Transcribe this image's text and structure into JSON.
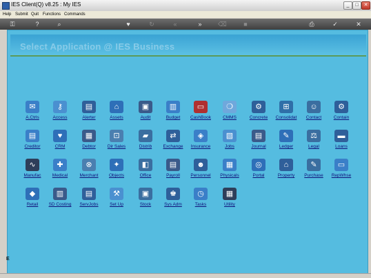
{
  "window": {
    "title": "IES Client(Q) v8.25 : My IES",
    "controls": [
      "_",
      "□",
      "✕"
    ]
  },
  "menu": {
    "items": [
      "Help",
      "Submit",
      "Quit",
      "Functions",
      "Commands"
    ]
  },
  "toolbar": {
    "buttons": [
      {
        "name": "key-icon",
        "glyph": "⚿",
        "dim": false
      },
      {
        "name": "help-icon",
        "glyph": "?",
        "dim": false
      },
      {
        "name": "search-icon",
        "glyph": "⌕",
        "dim": false
      },
      {
        "name": "heart-icon",
        "glyph": "♥",
        "dim": false
      },
      {
        "name": "refresh-icon",
        "glyph": "↻",
        "dim": true
      },
      {
        "name": "first-page-icon",
        "glyph": "«",
        "dim": true
      },
      {
        "name": "last-page-icon",
        "glyph": "»",
        "dim": false
      },
      {
        "name": "trash-icon",
        "glyph": "⌫",
        "dim": true
      },
      {
        "name": "stop-icon",
        "glyph": "■",
        "dim": true
      },
      {
        "name": "print-icon",
        "glyph": "⎙",
        "dim": false
      },
      {
        "name": "ok-icon",
        "glyph": "✓",
        "dim": false
      },
      {
        "name": "close-icon",
        "glyph": "✕",
        "dim": false
      }
    ]
  },
  "page": {
    "title": "Select Application @  IES Business",
    "bottom_marker": "E"
  },
  "colors": {
    "background": "#55bce0",
    "header": "#3aa3d4",
    "link": "#10107a"
  },
  "apps": [
    {
      "label": "A.Ctrls",
      "icon": "control-icon",
      "glyph": "✉",
      "color": "#3a7fc8"
    },
    {
      "label": "Access",
      "icon": "key-icon",
      "glyph": "⚷",
      "color": "#4a90d0"
    },
    {
      "label": "Alerter",
      "icon": "alert-panel-icon",
      "glyph": "▤",
      "color": "#2f5f9a"
    },
    {
      "label": "Assets",
      "icon": "house-icon",
      "glyph": "⌂",
      "color": "#2e6fb8"
    },
    {
      "label": "Audit",
      "icon": "monitor-icon",
      "glyph": "▣",
      "color": "#3a5a8a"
    },
    {
      "label": "Budget",
      "icon": "bar-chart-icon",
      "glyph": "▥",
      "color": "#3a7fc8"
    },
    {
      "label": "CashBook",
      "icon": "card-icon",
      "glyph": "▭",
      "color": "#b03030"
    },
    {
      "label": "CMMS",
      "icon": "bulb-icon",
      "glyph": "❍",
      "color": "#6fa8dc"
    },
    {
      "label": "Concrete",
      "icon": "gear-icon",
      "glyph": "⚙",
      "color": "#2e5f9a"
    },
    {
      "label": "Consolidat",
      "icon": "org-chart-icon",
      "glyph": "⊞",
      "color": "#2f6fa8"
    },
    {
      "label": "Contact",
      "icon": "people-icon",
      "glyph": "☺",
      "color": "#3a6ea0"
    },
    {
      "label": "Contain",
      "icon": "gears-icon",
      "glyph": "⚙",
      "color": "#2e5f9a"
    },
    {
      "label": "Creditor",
      "icon": "document-icon",
      "glyph": "▤",
      "color": "#3a7fc8"
    },
    {
      "label": "CRM",
      "icon": "heart-icon",
      "glyph": "♥",
      "color": "#2e6fb8"
    },
    {
      "label": "Debtor",
      "icon": "invoice-icon",
      "glyph": "▦",
      "color": "#3a5a8a"
    },
    {
      "label": "Dir Sales",
      "icon": "cart-icon",
      "glyph": "⊡",
      "color": "#4a7fb0"
    },
    {
      "label": "Distrib",
      "icon": "truck-icon",
      "glyph": "▰",
      "color": "#3a6ea0"
    },
    {
      "label": "Exchange",
      "icon": "exchange-icon",
      "glyph": "⇄",
      "color": "#2e5f9a"
    },
    {
      "label": "Insurance",
      "icon": "car-icon",
      "glyph": "◈",
      "color": "#3a7fc8"
    },
    {
      "label": "Jobs",
      "icon": "jobs-icon",
      "glyph": "▧",
      "color": "#4a90d0"
    },
    {
      "label": "Journal",
      "icon": "journal-icon",
      "glyph": "▤",
      "color": "#3a5a8a"
    },
    {
      "label": "Ledger",
      "icon": "ledger-icon",
      "glyph": "✎",
      "color": "#2e6fb8"
    },
    {
      "label": "Legal",
      "icon": "gavel-icon",
      "glyph": "⚖",
      "color": "#3a6ea0"
    },
    {
      "label": "Loans",
      "icon": "bank-card-icon",
      "glyph": "▬",
      "color": "#2f5f9a"
    },
    {
      "label": "Manufac",
      "icon": "wave-icon",
      "glyph": "∿",
      "color": "#2e3e5a"
    },
    {
      "label": "Medical",
      "icon": "medical-icon",
      "glyph": "✚",
      "color": "#3a7fc8"
    },
    {
      "label": "Merchant",
      "icon": "merchant-icon",
      "glyph": "⊗",
      "color": "#4a7fb0"
    },
    {
      "label": "Objects",
      "icon": "puzzle-icon",
      "glyph": "✦",
      "color": "#2e6fb8"
    },
    {
      "label": "Office",
      "icon": "office-icon",
      "glyph": "◧",
      "color": "#3a6ea0"
    },
    {
      "label": "Payroll",
      "icon": "payroll-icon",
      "glyph": "▤",
      "color": "#3a5a8a"
    },
    {
      "label": "Personnel",
      "icon": "personnel-icon",
      "glyph": "☻",
      "color": "#2e5f9a"
    },
    {
      "label": "Physicals",
      "icon": "physicals-icon",
      "glyph": "▦",
      "color": "#3a7fc8"
    },
    {
      "label": "Portal",
      "icon": "globe-icon",
      "glyph": "◎",
      "color": "#2e6fb8"
    },
    {
      "label": "Property",
      "icon": "building-icon",
      "glyph": "⌂",
      "color": "#2f5f9a"
    },
    {
      "label": "Purchase",
      "icon": "purchase-icon",
      "glyph": "✎",
      "color": "#3a6ea0"
    },
    {
      "label": "RepWhse",
      "icon": "warehouse-icon",
      "glyph": "▭",
      "color": "#3a7fc8"
    },
    {
      "label": "Retail",
      "icon": "tag-icon",
      "glyph": "◆",
      "color": "#2e6fb8"
    },
    {
      "label": "SD Costing",
      "icon": "costing-icon",
      "glyph": "▥",
      "color": "#3a5a8a"
    },
    {
      "label": "ServJobs",
      "icon": "servjobs-icon",
      "glyph": "▤",
      "color": "#2f5f9a"
    },
    {
      "label": "Set Up",
      "icon": "setup-icon",
      "glyph": "⚒",
      "color": "#4a90d0"
    },
    {
      "label": "Stock",
      "icon": "stock-icon",
      "glyph": "▣",
      "color": "#3a6ea0"
    },
    {
      "label": "Sys Adm",
      "icon": "sysadm-icon",
      "glyph": "♚",
      "color": "#2e5f9a"
    },
    {
      "label": "Tasks",
      "icon": "clock-icon",
      "glyph": "◷",
      "color": "#3a7fc8"
    },
    {
      "label": "Utility",
      "icon": "calculator-icon",
      "glyph": "▦",
      "color": "#2e3e5a"
    }
  ]
}
